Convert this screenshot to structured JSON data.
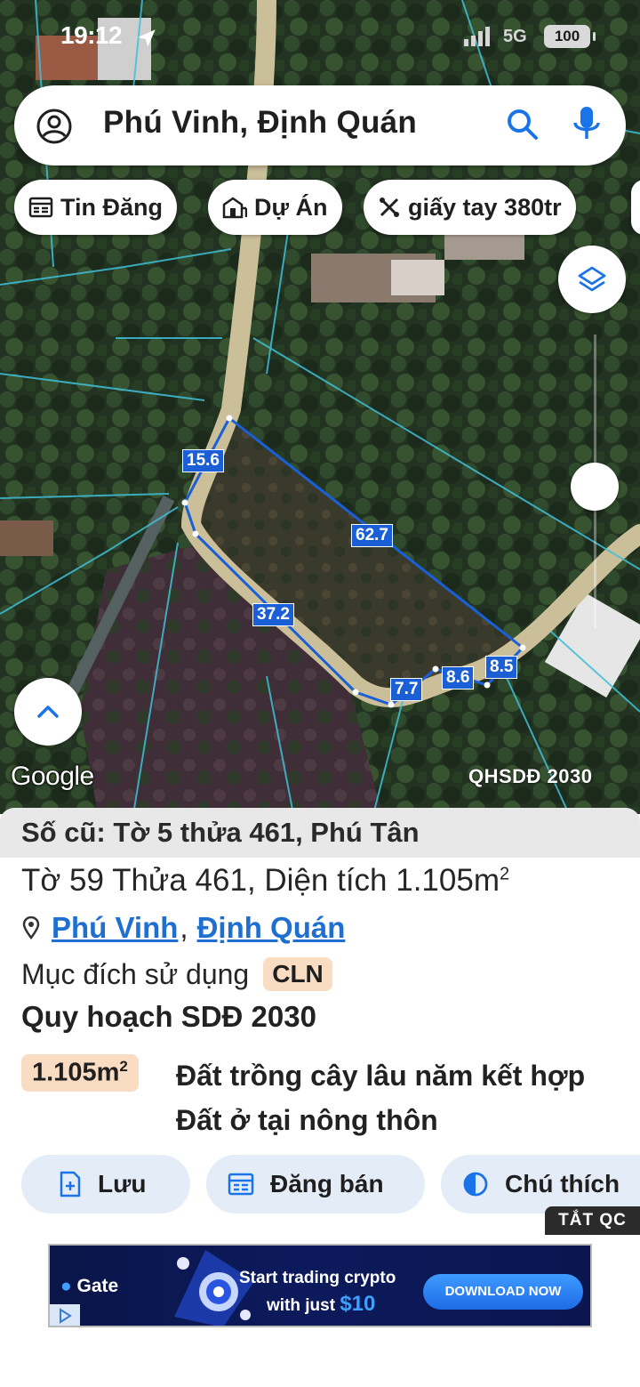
{
  "status_bar": {
    "time": "19:12",
    "network": "5G",
    "battery": "100"
  },
  "search": {
    "query": "Phú Vinh, Định Quán",
    "icons": [
      "account-circle-icon",
      "search-icon",
      "microphone-icon"
    ]
  },
  "chips": [
    {
      "label": "Tin Đăng",
      "icon": "listing-icon"
    },
    {
      "label": "Dự Án",
      "icon": "project-building-icon"
    },
    {
      "label": "giấy tay 380tr",
      "icon": "tools-icon"
    }
  ],
  "map": {
    "dimensions": [
      "15.6",
      "62.7",
      "37.2",
      "7.7",
      "8.6",
      "8.5"
    ],
    "provider": "Google",
    "plan_overlay": "QHSDĐ 2030",
    "boundary_color": "#1a5fd6"
  },
  "parcel": {
    "old_number": "Số cũ: Tờ 5 thửa 461, Phú Tân",
    "summary": "Tờ 59 Thửa 461, Diện tích 1.105m",
    "summary_sup": "2",
    "ward": "Phú Vinh",
    "district": "Định Quán",
    "separator": ",",
    "purpose_label": "Mục đích sử dụng",
    "purpose_code": "CLN",
    "plan_title": "Quy hoạch SDĐ 2030",
    "plan_area": "1.105m",
    "plan_area_sup": "2",
    "plan_land_use": "Đất trồng cây lâu năm kết hợp Đất ở tại nông thôn"
  },
  "actions": [
    {
      "label": "Lưu",
      "icon": "save-icon"
    },
    {
      "label": "Đăng bán",
      "icon": "post-sale-icon"
    },
    {
      "label": "Chú thích",
      "icon": "legend-icon"
    }
  ],
  "ad": {
    "close_label": "TẮT QC",
    "brand": "Gate",
    "line1": "Start trading crypto",
    "line2_prefix": "with just ",
    "line2_price": "$10",
    "cta": "DOWNLOAD NOW"
  }
}
